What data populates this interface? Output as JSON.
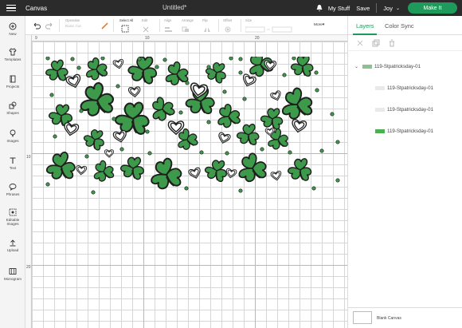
{
  "topbar": {
    "app_title": "Canvas",
    "doc_title": "Untitled*",
    "my_stuff": "My Stuff",
    "save": "Save",
    "user": "Joy",
    "user_chevron": "⌄",
    "make_it": "Make It"
  },
  "sidebar": {
    "items": [
      {
        "label": "New",
        "icon": "plus-circle-icon"
      },
      {
        "label": "Templates",
        "icon": "shirt-icon"
      },
      {
        "label": "Projects",
        "icon": "book-icon"
      },
      {
        "label": "Shapes",
        "icon": "shapes-icon"
      },
      {
        "label": "Images",
        "icon": "lightbulb-icon"
      },
      {
        "label": "Text",
        "icon": "text-icon"
      },
      {
        "label": "Phrases",
        "icon": "speech-bubble-icon"
      },
      {
        "label": "Editable Images",
        "icon": "editable-image-icon"
      },
      {
        "label": "Upload",
        "icon": "upload-icon"
      },
      {
        "label": "Monogram",
        "icon": "monogram-icon"
      }
    ]
  },
  "toolbar": {
    "operation_label": "Operation",
    "operation_value": "Basic Cut",
    "select_all": "Select All",
    "edit": "Edit",
    "align": "Align",
    "arrange": "Arrange",
    "flip": "Flip",
    "offset": "Offset",
    "size": "Size",
    "more": "More▾"
  },
  "rulers": {
    "top": [
      "9",
      "10",
      "20"
    ],
    "left": [
      "10",
      "20"
    ]
  },
  "panel": {
    "tabs": [
      "Layers",
      "Color Sync"
    ],
    "group": {
      "expanded_icon": "⌄",
      "name": "119-Stpatricksday-01"
    },
    "layers": [
      {
        "name": "119-Stpatricksday-01",
        "color": "#e9e9e9"
      },
      {
        "name": "119-Stpatricksday-01",
        "color": "#e9e9e9"
      },
      {
        "name": "119-Stpatricksday-01",
        "color": "#4caf50"
      }
    ],
    "blank_canvas": "Blank Canvas"
  },
  "colors": {
    "accent": "#1e9a5a",
    "clover_fill": "#3d9a4a",
    "clover_stroke": "#1f1f1f",
    "topbar_bg": "#2b2b2b"
  }
}
